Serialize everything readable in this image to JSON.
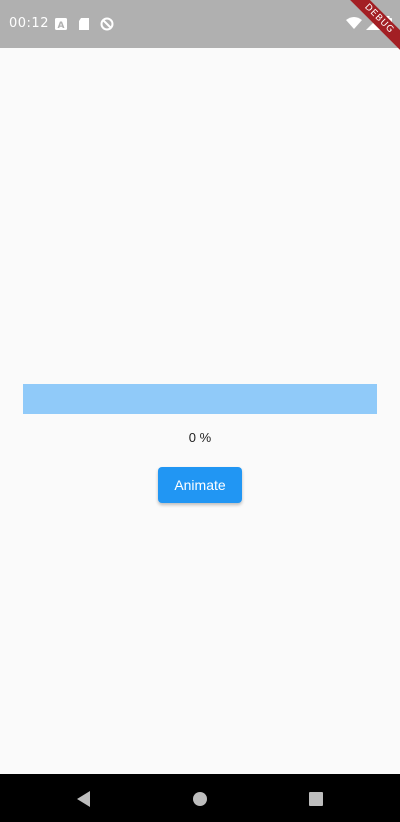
{
  "status_bar": {
    "time": "00:12",
    "icons_left": [
      "notification-a-icon",
      "sd-card-icon",
      "no-sync-icon"
    ],
    "icons_right": [
      "wifi-icon",
      "signal-icon",
      "battery-icon"
    ]
  },
  "debug_banner": {
    "label": "DEBUG",
    "color": "#a31f24"
  },
  "progress": {
    "value": 0,
    "label": "0 %",
    "track_color": "#90caf9",
    "fill_color": "#2196f3"
  },
  "animate_button": {
    "label": "Animate",
    "color": "#2196f3"
  },
  "nav_bar": {
    "icons": [
      "back-icon",
      "home-icon",
      "recents-icon"
    ]
  }
}
